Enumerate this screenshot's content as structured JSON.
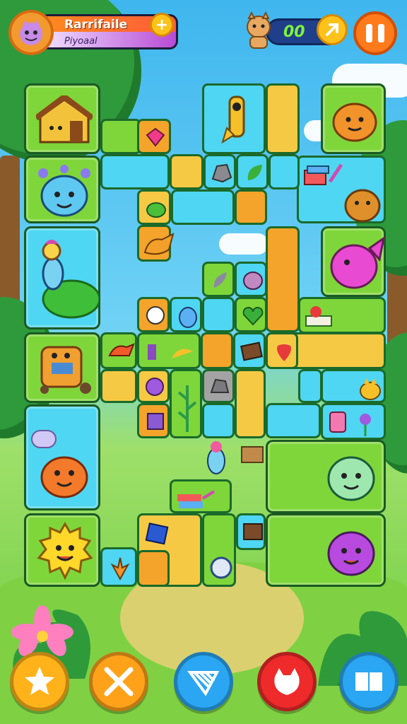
{
  "hud": {
    "title": "Rarrifaile",
    "subtitle": "Piyoaal",
    "counter": "00",
    "plus_label": "+"
  },
  "icons": {
    "avatar": "monster-avatar-icon",
    "plus": "plus-icon",
    "pet": "pet-icon",
    "coin": "coin-icon",
    "pause": "pause-icon",
    "star": "star-icon",
    "tools": "tools-icon",
    "net": "net-icon",
    "monster": "monster-icon",
    "book": "book-icon"
  },
  "colors": {
    "grass": "#7fd63a",
    "water": "#4fd6f2",
    "sand": "#f6c945",
    "path": "#f4a42a",
    "accent": "#ff7a1a",
    "counter": "#7ef23a"
  }
}
